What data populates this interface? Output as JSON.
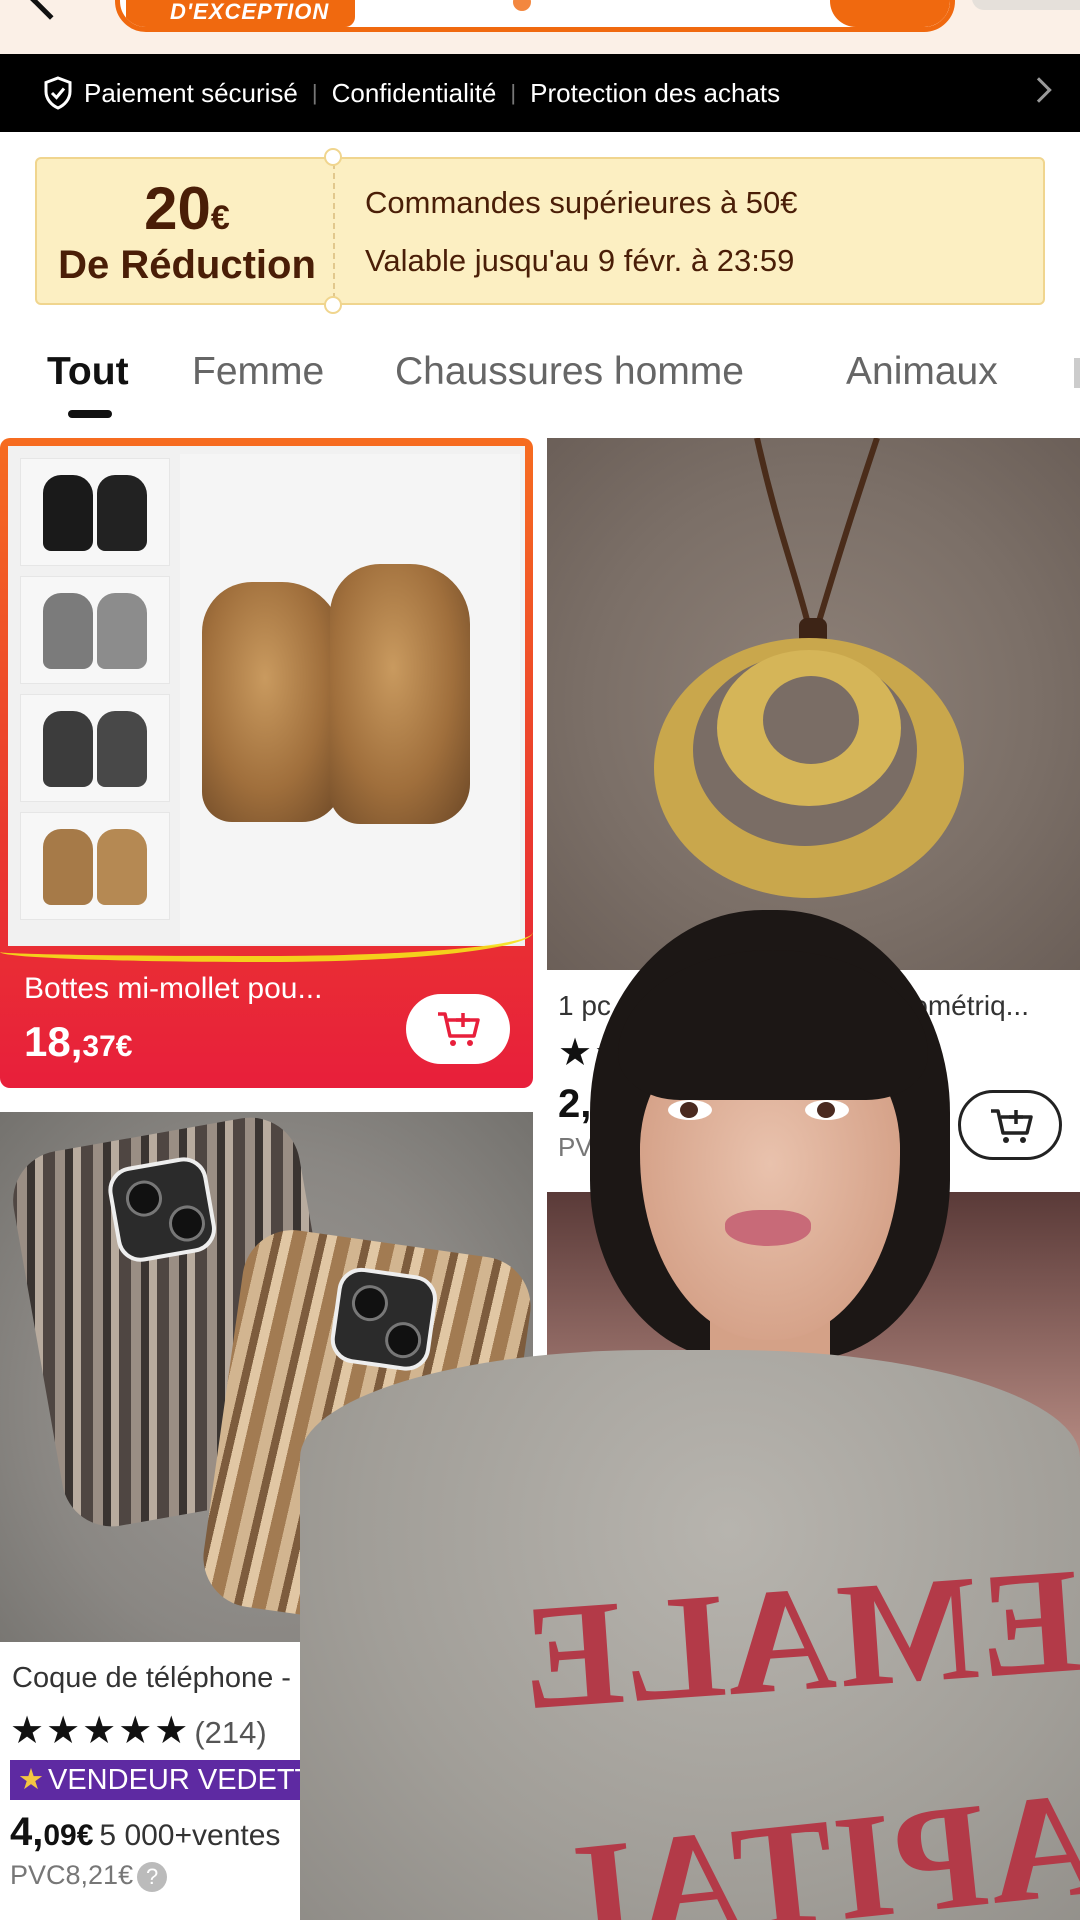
{
  "search": {
    "badge_text": "D'EXCEPTION"
  },
  "trust_bar": {
    "items": [
      "Paiement sécurisé",
      "Confidentialité",
      "Protection des achats"
    ]
  },
  "coupon": {
    "amount": "20",
    "currency": "€",
    "label": "De Réduction",
    "condition": "Commandes supérieures à 50€",
    "validity": "Valable jusqu'au 9 févr. à 23:59"
  },
  "tabs": [
    "Tout",
    "Femme",
    "Chaussures homme",
    "Animaux"
  ],
  "products": [
    {
      "title": "Bottes mi-mollet pou...",
      "price_main": "18,",
      "price_cents": "37€"
    },
    {
      "title": "1 pc. C",
      "title_end": "éométriq...",
      "stars": "★★",
      "price_partial": "2,9",
      "pvc_partial": "PVC"
    },
    {
      "title": "Coque de téléphone - Coque d",
      "stars": "★★★★★",
      "review_count": "(214)",
      "badge": "VENDEUR VEDETTE",
      "price_main": "4,",
      "price_cents": "09€",
      "sales": "5 000+ventes",
      "pvc": "PVC8,21€"
    }
  ],
  "sweater_print": {
    "line1": "FEMALE",
    "line2": "CAPITAL"
  },
  "colors": {
    "accent": "#f0690f",
    "highlight_card": "#e81f3b",
    "badge_purple": "#5e2aa2",
    "coupon_bg": "#fcefc2"
  }
}
